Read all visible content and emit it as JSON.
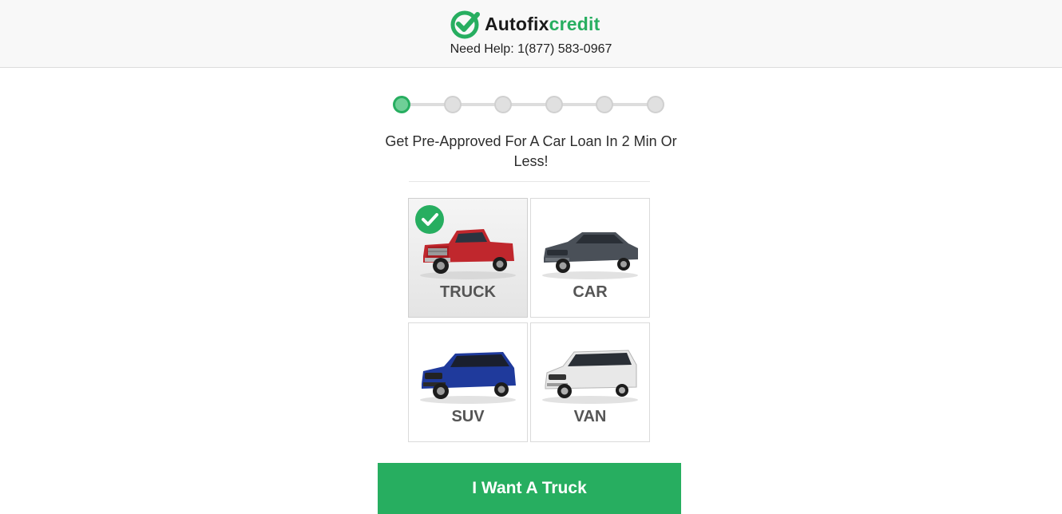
{
  "header": {
    "brand_part1": "Autofix",
    "brand_part2": "credit",
    "help_text": "Need Help: 1(877) 583-0967",
    "logo_icon": "check-circle-logo-icon"
  },
  "progress": {
    "total_steps": 6,
    "current_step": 1
  },
  "headline": "Get Pre-Approved For A Car Loan In 2 Min Or Less!",
  "vehicle_options": [
    {
      "label": "TRUCK",
      "selected": true,
      "icon": "truck-icon",
      "color": "#c0272d"
    },
    {
      "label": "CAR",
      "selected": false,
      "icon": "sedan-icon",
      "color": "#4a5058"
    },
    {
      "label": "SUV",
      "selected": false,
      "icon": "suv-icon",
      "color": "#1f3a9c"
    },
    {
      "label": "VAN",
      "selected": false,
      "icon": "van-icon",
      "color": "#e8e8e8"
    }
  ],
  "cta_label": "I Want A Truck",
  "colors": {
    "accent": "#27ae60",
    "progress_inactive": "#e0e0e0"
  }
}
